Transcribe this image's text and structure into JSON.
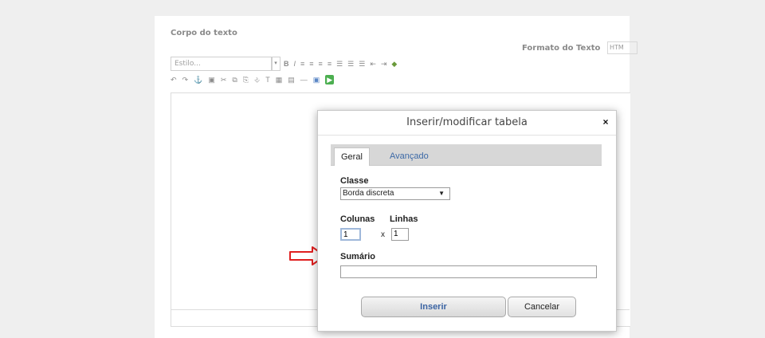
{
  "editor": {
    "title": "Corpo do texto",
    "format_label": "Formato do Texto",
    "format_value": "HTM",
    "style_placeholder": "Estilo..."
  },
  "toolbar_row1": [
    "B",
    "I",
    "≡",
    "≡",
    "≡",
    "≡",
    "☰",
    "☰",
    "☰",
    "⇤",
    "⇥",
    "◆"
  ],
  "toolbar_row2": [
    "↶",
    "↷",
    "⚓",
    "▣",
    "✂",
    "⧉",
    "⎘",
    "⎀",
    "T",
    "▦",
    "▤",
    "—",
    "▣",
    "▶"
  ],
  "dialog": {
    "title": "Inserir/modificar tabela",
    "close": "×",
    "tabs": [
      {
        "label": "Geral",
        "active": true
      },
      {
        "label": "Avançado",
        "active": false
      }
    ],
    "classe_label": "Classe",
    "classe_value": "Borda discreta",
    "colunas_label": "Colunas",
    "linhas_label": "Linhas",
    "colunas_value": "1",
    "linhas_value": "1",
    "separator": "x",
    "sumario_label": "Sumário",
    "insert_label": "Inserir",
    "cancel_label": "Cancelar"
  },
  "colors": {
    "accent_link": "#3d6aa7",
    "annotation_arrow": "#e02020"
  }
}
